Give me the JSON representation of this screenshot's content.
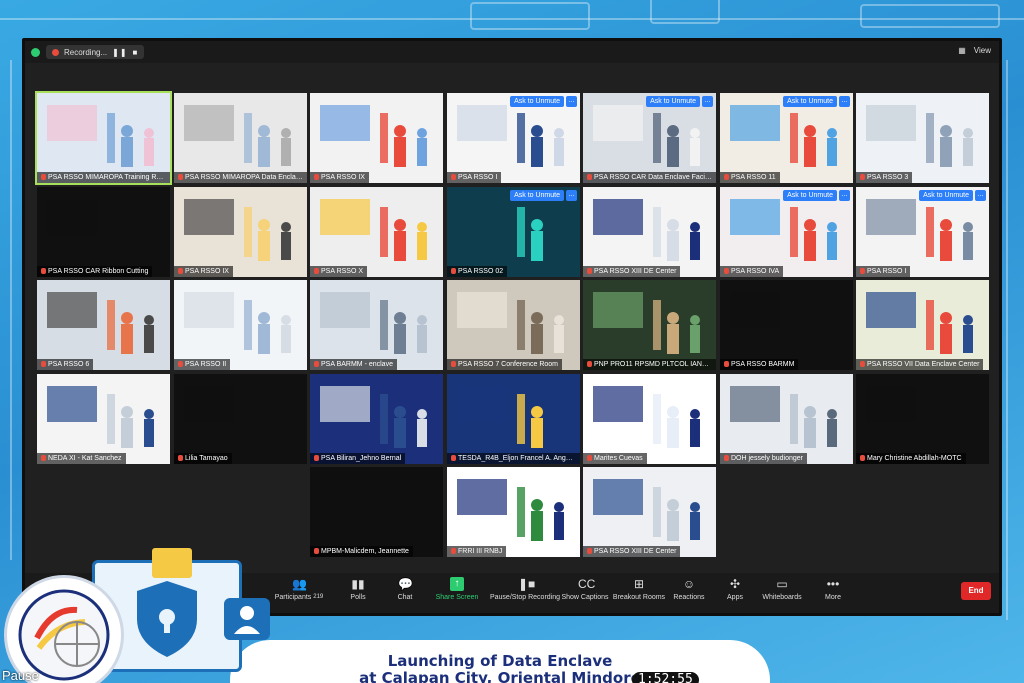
{
  "topbar": {
    "recording_label": "Recording...",
    "pause_icon": "pause-icon",
    "stop_icon": "stop-icon",
    "view_label": "View"
  },
  "tiles": [
    {
      "name": "PSA RSSO MIMAROPA Training Room",
      "active": true,
      "unmute": false
    },
    {
      "name": "PSA RSSO MIMAROPA Data Enclave",
      "active": false,
      "unmute": false
    },
    {
      "name": "PSA RSSO IX",
      "active": false,
      "unmute": false
    },
    {
      "name": "PSA RSSO I",
      "active": false,
      "unmute": true
    },
    {
      "name": "PSA RSSO CAR Data Enclave Facility",
      "active": false,
      "unmute": true
    },
    {
      "name": "PSA RSSO 11",
      "active": false,
      "unmute": true
    },
    {
      "name": "PSA RSSO 3",
      "active": false,
      "unmute": false
    },
    {
      "name": "PSA RSSO CAR Ribbon Cutting",
      "active": false,
      "unmute": false
    },
    {
      "name": "PSA RSSO IX",
      "active": false,
      "unmute": false
    },
    {
      "name": "PSA RSSO X",
      "active": false,
      "unmute": false
    },
    {
      "name": "PSA RSSO 02",
      "active": false,
      "unmute": true
    },
    {
      "name": "PSA RSSO XIII DE Center",
      "active": false,
      "unmute": false
    },
    {
      "name": "PSA RSSO IVA",
      "active": false,
      "unmute": true
    },
    {
      "name": "PSA RSSO I",
      "active": false,
      "unmute": true
    },
    {
      "name": "PSA RSSO 6",
      "active": false,
      "unmute": false
    },
    {
      "name": "PSA RSSO II",
      "active": false,
      "unmute": false
    },
    {
      "name": "PSA BARMM - enclave",
      "active": false,
      "unmute": false
    },
    {
      "name": "PSA RSSO 7 Conference Room",
      "active": false,
      "unmute": false
    },
    {
      "name": "PNP PRO11 RPSMD PLTCOL IANOG",
      "active": false,
      "unmute": false
    },
    {
      "name": "PSA RSSO BARMM",
      "active": false,
      "unmute": false
    },
    {
      "name": "PSA RSSO VII Data Enclave Center",
      "active": false,
      "unmute": false
    },
    {
      "name": "NEDA XI - Kat Sanchez",
      "active": false,
      "unmute": false
    },
    {
      "name": "Lilia Tamayao",
      "active": false,
      "unmute": false
    },
    {
      "name": "PSA Biliran_Jehno Bernal",
      "active": false,
      "unmute": false
    },
    {
      "name": "TESDA_R4B_Eljon Francel A. Angeles",
      "active": false,
      "unmute": false
    },
    {
      "name": "Marites Cuevas",
      "active": false,
      "unmute": false
    },
    {
      "name": "DOH jessely budionger",
      "active": false,
      "unmute": false
    },
    {
      "name": "Mary Christine Abdillah-MOTC",
      "active": false,
      "unmute": false
    },
    {
      "name": "MPBM-Malicdem, Jeannette",
      "active": false,
      "unmute": false
    },
    {
      "name": "FRRI III RNBJ",
      "active": false,
      "unmute": false
    },
    {
      "name": "PSA RSSO XIII DE Center",
      "active": false,
      "unmute": false
    }
  ],
  "tile_labels": {
    "ask_to_unmute": "Ask to Unmute",
    "more": "..."
  },
  "toolbar": {
    "participants_label": "Participants",
    "participants_count": "219",
    "polls_label": "Polls",
    "chat_label": "Chat",
    "share_label": "Share Screen",
    "record_label": "Pause/Stop Recording",
    "captions_label": "Show Captions",
    "breakout_label": "Breakout Rooms",
    "reactions_label": "Reactions",
    "apps_label": "Apps",
    "whiteboards_label": "Whiteboards",
    "more_label": "More",
    "end_label": "End"
  },
  "banner": {
    "title_line1": "Launching of Data Enclave",
    "title_line2": "at Calapan City, Oriental Mindoro",
    "pause_label": "Pause",
    "timer": "1:52:55"
  },
  "colors": {
    "background": "#2a8fd2",
    "window": "#202020",
    "active_speaker": "#a8e05b",
    "unmute_blue": "#2d7ff9",
    "end_red": "#e02828",
    "banner_text": "#1b2f7a"
  }
}
